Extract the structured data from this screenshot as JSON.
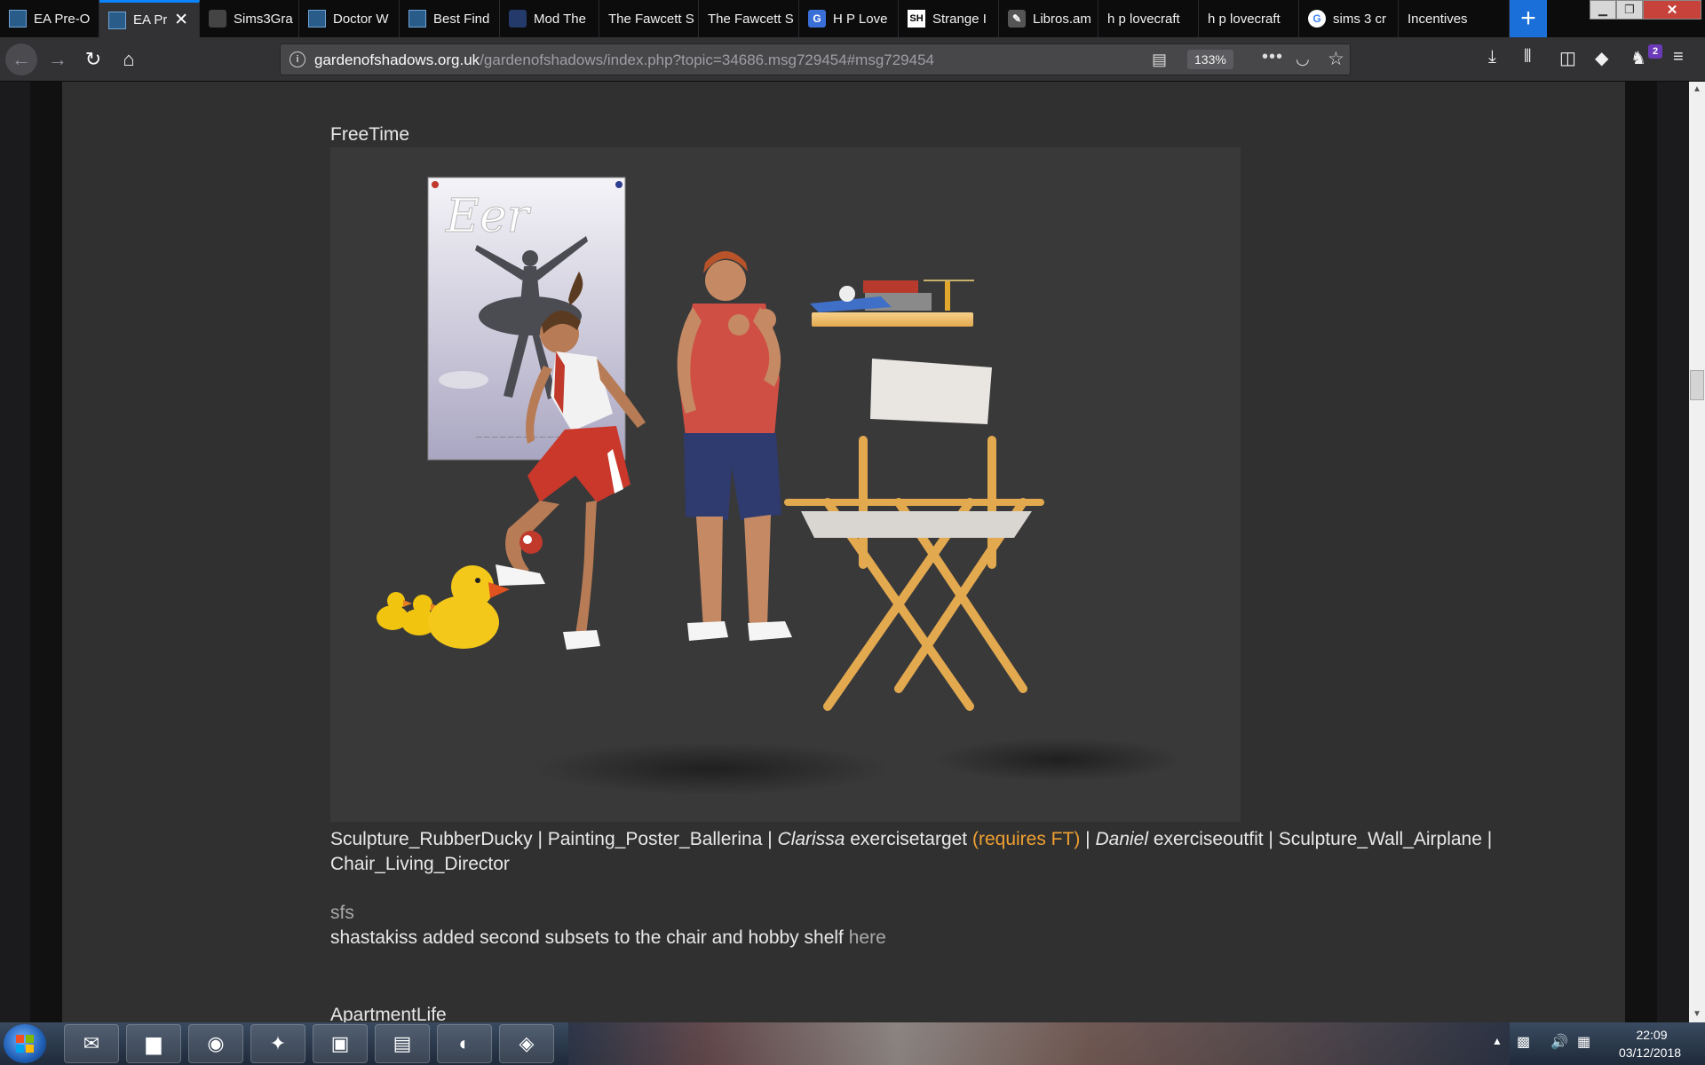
{
  "tabs": [
    {
      "label": "EA Pre-O",
      "icon": "ea-garden-icon"
    },
    {
      "label": "EA Pr",
      "icon": "ea-garden-icon",
      "active": true
    },
    {
      "label": "Sims3Gra",
      "icon": "page-icon"
    },
    {
      "label": "Doctor W",
      "icon": "ea-garden-icon"
    },
    {
      "label": "Best Find",
      "icon": "ea-garden-icon"
    },
    {
      "label": "Mod The",
      "icon": "cube-icon"
    },
    {
      "label": "The Fawcett S",
      "icon": ""
    },
    {
      "label": "The Fawcett S",
      "icon": ""
    },
    {
      "label": "H P Love",
      "icon": "g-icon"
    },
    {
      "label": "Strange I",
      "icon": "sh-icon"
    },
    {
      "label": "Libros.am",
      "icon": "book-icon"
    },
    {
      "label": "h p lovecraft",
      "icon": ""
    },
    {
      "label": "h p lovecraft",
      "icon": ""
    },
    {
      "label": "sims 3 cr",
      "icon": "google-icon"
    },
    {
      "label": "Incentives",
      "icon": ""
    }
  ],
  "window": {
    "close_label": "✕",
    "new_tab_label": "+"
  },
  "address_bar": {
    "domain": "gardenofshadows.org.uk",
    "path": "/gardenofshadows/index.php?topic=34686.msg729454#msg729454",
    "zoom": "133%"
  },
  "toolbar": {
    "notification_count": "2"
  },
  "content": {
    "section_title": "FreeTime",
    "caption": {
      "item1": "Sculpture_RubberDucky",
      "item2": "Painting_Poster_Ballerina",
      "sim1": "Clarissa",
      "item3": "exercisetarget",
      "requires": "(requires FT)",
      "sim2": "Daniel",
      "item4": "exerciseoutfit",
      "item5": "Sculpture_Wall_Airplane",
      "item6": "Chair_Living_Director",
      "separator": " | "
    },
    "sfs_label": "sfs",
    "note_text": "shastakiss added second subsets to the chair and hobby shelf ",
    "note_link": "here",
    "next_section_title": "ApartmentLife"
  },
  "taskbar": {
    "clock_time": "22:09",
    "clock_date": "03/12/2018",
    "apps": [
      "thunderbird-icon",
      "file-explorer-icon",
      "firefox-icon",
      "pidgin-icon",
      "app-icon",
      "winrar-icon",
      "dreamweaver-icon",
      "app-icon"
    ]
  },
  "colors": {
    "accent": "#0a84ff",
    "link_orange": "#f0a030",
    "content_bg": "#303031"
  }
}
